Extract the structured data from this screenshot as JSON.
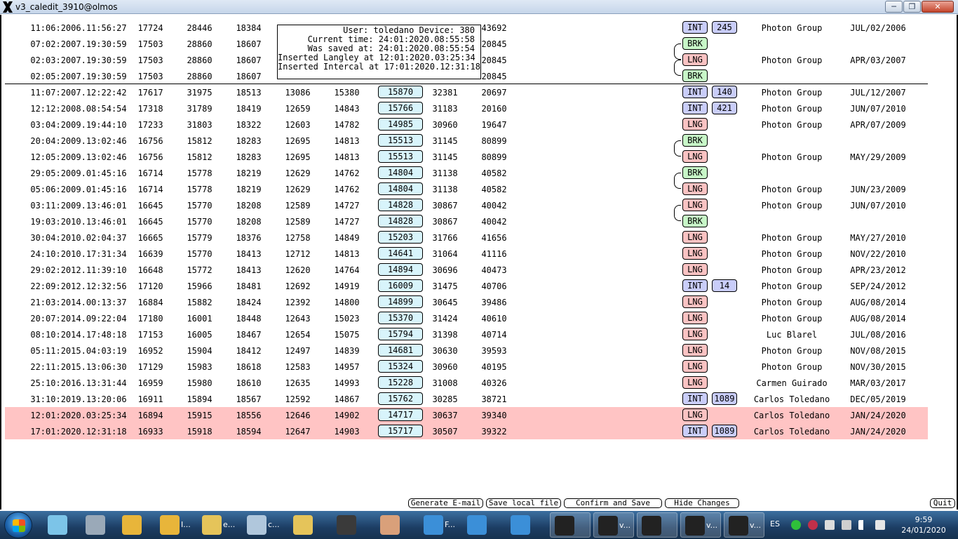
{
  "window": {
    "title": "v3_caledit_3910@olmos",
    "minimize": "─",
    "maximize": "❐",
    "close": "✕"
  },
  "tooltip": {
    "user_line": "User: toledano Device: 380",
    "current_time": "Current time: 24:01:2020.08:55:58",
    "saved_at": "Was saved at: 24:01:2020.08:55:54",
    "langley": "Inserted Langley at 12:01:2020.03:25:34",
    "intercal": "Inserted Intercal at 17:01:2020.12:31:18"
  },
  "rows": [
    {
      "date": "11:06:2006.11:56:27",
      "v": [
        "17724",
        "28446",
        "18384",
        "",
        "",
        ""
      ],
      "v7": "",
      "v8": "43692",
      "tag": "INT",
      "num": "245",
      "who": "Photon Group",
      "cdate": "JUL/02/2006"
    },
    {
      "date": "07:02:2007.19:30:59",
      "v": [
        "17503",
        "28860",
        "18607",
        "",
        "",
        ""
      ],
      "v7": "",
      "v8": "20845",
      "tag": "BRK",
      "num": "",
      "who": "",
      "cdate": ""
    },
    {
      "date": "02:03:2007.19:30:59",
      "v": [
        "17503",
        "28860",
        "18607",
        "",
        "",
        ""
      ],
      "v7": "",
      "v8": "20845",
      "tag": "LNG",
      "num": "",
      "who": "Photon Group",
      "cdate": "APR/03/2007"
    },
    {
      "date": "02:05:2007.19:30:59",
      "v": [
        "17503",
        "28860",
        "18607",
        "",
        "",
        ""
      ],
      "v7": "",
      "v8": "20845",
      "tag": "BRK",
      "num": "",
      "who": "",
      "cdate": ""
    },
    {
      "date": "11:07:2007.12:22:42",
      "v": [
        "17617",
        "31975",
        "18513",
        "13086",
        "15380",
        "15870"
      ],
      "v7": "32381",
      "v8": "20697",
      "tag": "INT",
      "num": "140",
      "who": "Photon Group",
      "cdate": "JUL/12/2007"
    },
    {
      "date": "12:12:2008.08:54:54",
      "v": [
        "17318",
        "31789",
        "18419",
        "12659",
        "14843",
        "15766"
      ],
      "v7": "31183",
      "v8": "20160",
      "tag": "INT",
      "num": "421",
      "who": "Photon Group",
      "cdate": "JUN/07/2010"
    },
    {
      "date": "03:04:2009.19:44:10",
      "v": [
        "17233",
        "31803",
        "18322",
        "12603",
        "14782",
        "14985"
      ],
      "v7": "30960",
      "v8": "19647",
      "tag": "LNG",
      "num": "",
      "who": "Photon Group",
      "cdate": "APR/07/2009"
    },
    {
      "date": "20:04:2009.13:02:46",
      "v": [
        "16756",
        "15812",
        "18283",
        "12695",
        "14813",
        "15513"
      ],
      "v7": "31145",
      "v8": "80899",
      "tag": "BRK",
      "num": "",
      "who": "",
      "cdate": ""
    },
    {
      "date": "12:05:2009.13:02:46",
      "v": [
        "16756",
        "15812",
        "18283",
        "12695",
        "14813",
        "15513"
      ],
      "v7": "31145",
      "v8": "80899",
      "tag": "LNG",
      "num": "",
      "who": "Photon Group",
      "cdate": "MAY/29/2009"
    },
    {
      "date": "29:05:2009.01:45:16",
      "v": [
        "16714",
        "15778",
        "18219",
        "12629",
        "14762",
        "14804"
      ],
      "v7": "31138",
      "v8": "40582",
      "tag": "BRK",
      "num": "",
      "who": "",
      "cdate": ""
    },
    {
      "date": "05:06:2009.01:45:16",
      "v": [
        "16714",
        "15778",
        "18219",
        "12629",
        "14762",
        "14804"
      ],
      "v7": "31138",
      "v8": "40582",
      "tag": "LNG",
      "num": "",
      "who": "Photon Group",
      "cdate": "JUN/23/2009"
    },
    {
      "date": "03:11:2009.13:46:01",
      "v": [
        "16645",
        "15770",
        "18208",
        "12589",
        "14727",
        "14828"
      ],
      "v7": "30867",
      "v8": "40042",
      "tag": "LNG",
      "num": "",
      "who": "Photon Group",
      "cdate": "JUN/07/2010"
    },
    {
      "date": "19:03:2010.13:46:01",
      "v": [
        "16645",
        "15770",
        "18208",
        "12589",
        "14727",
        "14828"
      ],
      "v7": "30867",
      "v8": "40042",
      "tag": "BRK",
      "num": "",
      "who": "",
      "cdate": ""
    },
    {
      "date": "30:04:2010.02:04:37",
      "v": [
        "16665",
        "15779",
        "18376",
        "12758",
        "14849",
        "15203"
      ],
      "v7": "31766",
      "v8": "41656",
      "tag": "LNG",
      "num": "",
      "who": "Photon Group",
      "cdate": "MAY/27/2010"
    },
    {
      "date": "24:10:2010.17:31:34",
      "v": [
        "16639",
        "15770",
        "18413",
        "12712",
        "14813",
        "14641"
      ],
      "v7": "31064",
      "v8": "41116",
      "tag": "LNG",
      "num": "",
      "who": "Photon Group",
      "cdate": "NOV/22/2010"
    },
    {
      "date": "29:02:2012.11:39:10",
      "v": [
        "16648",
        "15772",
        "18413",
        "12620",
        "14764",
        "14894"
      ],
      "v7": "30696",
      "v8": "40473",
      "tag": "LNG",
      "num": "",
      "who": "Photon Group",
      "cdate": "APR/23/2012"
    },
    {
      "date": "22:09:2012.12:32:56",
      "v": [
        "17120",
        "15966",
        "18481",
        "12692",
        "14919",
        "16009"
      ],
      "v7": "31475",
      "v8": "40706",
      "tag": "INT",
      "num": "14",
      "who": "Photon Group",
      "cdate": "SEP/24/2012"
    },
    {
      "date": "21:03:2014.00:13:37",
      "v": [
        "16884",
        "15882",
        "18424",
        "12392",
        "14800",
        "14899"
      ],
      "v7": "30645",
      "v8": "39486",
      "tag": "LNG",
      "num": "",
      "who": "Photon Group",
      "cdate": "AUG/08/2014"
    },
    {
      "date": "20:07:2014.09:22:04",
      "v": [
        "17180",
        "16001",
        "18448",
        "12643",
        "15023",
        "15370"
      ],
      "v7": "31424",
      "v8": "40610",
      "tag": "LNG",
      "num": "",
      "who": "Photon Group",
      "cdate": "AUG/08/2014"
    },
    {
      "date": "08:10:2014.17:48:18",
      "v": [
        "17153",
        "16005",
        "18467",
        "12654",
        "15075",
        "15794"
      ],
      "v7": "31398",
      "v8": "40714",
      "tag": "LNG",
      "num": "",
      "who": "Luc Blarel",
      "cdate": "JUL/08/2016"
    },
    {
      "date": "05:11:2015.04:03:19",
      "v": [
        "16952",
        "15904",
        "18412",
        "12497",
        "14839",
        "14681"
      ],
      "v7": "30630",
      "v8": "39593",
      "tag": "LNG",
      "num": "",
      "who": "Photon Group",
      "cdate": "NOV/08/2015"
    },
    {
      "date": "22:11:2015.13:06:30",
      "v": [
        "17129",
        "15983",
        "18618",
        "12583",
        "14957",
        "15324"
      ],
      "v7": "30960",
      "v8": "40195",
      "tag": "LNG",
      "num": "",
      "who": "Photon Group",
      "cdate": "NOV/30/2015"
    },
    {
      "date": "25:10:2016.13:31:44",
      "v": [
        "16959",
        "15980",
        "18610",
        "12635",
        "14993",
        "15228"
      ],
      "v7": "31008",
      "v8": "40326",
      "tag": "LNG",
      "num": "",
      "who": "Carmen Guirado",
      "cdate": "MAR/03/2017"
    },
    {
      "date": "31:10:2019.13:20:06",
      "v": [
        "16911",
        "15894",
        "18567",
        "12592",
        "14867",
        "15762"
      ],
      "v7": "30285",
      "v8": "38721",
      "tag": "INT",
      "num": "1089",
      "who": "Carlos Toledano",
      "cdate": "DEC/05/2019"
    },
    {
      "date": "12:01:2020.03:25:34",
      "v": [
        "16894",
        "15915",
        "18556",
        "12646",
        "14902",
        "14717"
      ],
      "v7": "30637",
      "v8": "39340",
      "tag": "LNG",
      "num": "",
      "who": "Carlos Toledano",
      "cdate": "JAN/24/2020",
      "selected": true
    },
    {
      "date": "17:01:2020.12:31:18",
      "v": [
        "16933",
        "15918",
        "18594",
        "12647",
        "14903",
        "15717"
      ],
      "v7": "30507",
      "v8": "39322",
      "tag": "INT",
      "num": "1089",
      "who": "Carlos Toledano",
      "cdate": "JAN/24/2020",
      "selected": true
    }
  ],
  "links": [
    [
      1,
      2
    ],
    [
      2,
      3
    ],
    [
      7,
      8
    ],
    [
      9,
      10
    ],
    [
      11,
      12
    ]
  ],
  "buttons": {
    "generate_email": "Generate E-mail",
    "save_local": "Save local file",
    "confirm_save": "Confirm and Save",
    "hide_changes": "Hide Changes",
    "quit": "Quit"
  },
  "taskbar": {
    "items": [
      {
        "name": "taskbar-explorer-notes",
        "label": "",
        "color": "#7cc4e8"
      },
      {
        "name": "taskbar-calculator",
        "label": "",
        "color": "#9aa9b8"
      },
      {
        "name": "taskbar-chrome-1",
        "label": "",
        "color": "#e8b53a"
      },
      {
        "name": "taskbar-chrome-2",
        "label": "I...",
        "color": "#e8b53a"
      },
      {
        "name": "taskbar-folder-1",
        "label": "e...",
        "color": "#e5c45a"
      },
      {
        "name": "taskbar-search",
        "label": "c...",
        "color": "#b0c7dc"
      },
      {
        "name": "taskbar-folder-2",
        "label": "",
        "color": "#e5c45a"
      },
      {
        "name": "taskbar-terminal",
        "label": "",
        "color": "#3a3a3a"
      },
      {
        "name": "taskbar-paint",
        "label": "",
        "color": "#d9a07a"
      },
      {
        "name": "taskbar-ie-1",
        "label": "F...",
        "color": "#3b8fd8"
      },
      {
        "name": "taskbar-ie-2",
        "label": "",
        "color": "#3b8fd8"
      },
      {
        "name": "taskbar-ie-3",
        "label": "",
        "color": "#3b8fd8"
      },
      {
        "name": "taskbar-x-1",
        "label": "",
        "color": "#222222"
      },
      {
        "name": "taskbar-x-2",
        "label": "v...",
        "color": "#222222"
      },
      {
        "name": "taskbar-x-3",
        "label": "",
        "color": "#222222"
      },
      {
        "name": "taskbar-x-4",
        "label": "v...",
        "color": "#222222"
      },
      {
        "name": "taskbar-x-5",
        "label": "v...",
        "color": "#222222"
      }
    ],
    "language": "ES",
    "time": "9:59",
    "date": "24/01/2020"
  }
}
